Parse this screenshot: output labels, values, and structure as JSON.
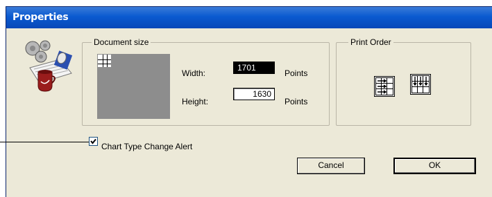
{
  "window": {
    "title": "Properties"
  },
  "document_size": {
    "label": "Document size",
    "width_label": "Width:",
    "width_value": "1701",
    "width_unit": "Points",
    "height_label": "Height:",
    "height_value": "1630",
    "height_unit": "Points"
  },
  "print_order": {
    "label": "Print Order",
    "options": [
      "order-across-then-down-icon",
      "order-down-then-across-icon"
    ]
  },
  "chart_alert": {
    "label": "Chart Type Change Alert",
    "checked": true
  },
  "buttons": {
    "cancel": "Cancel",
    "ok": "OK"
  },
  "colors": {
    "titlebar": "#0a5ad0",
    "dialog_bg": "#ece9d8",
    "preview": "#8d8d8d"
  }
}
